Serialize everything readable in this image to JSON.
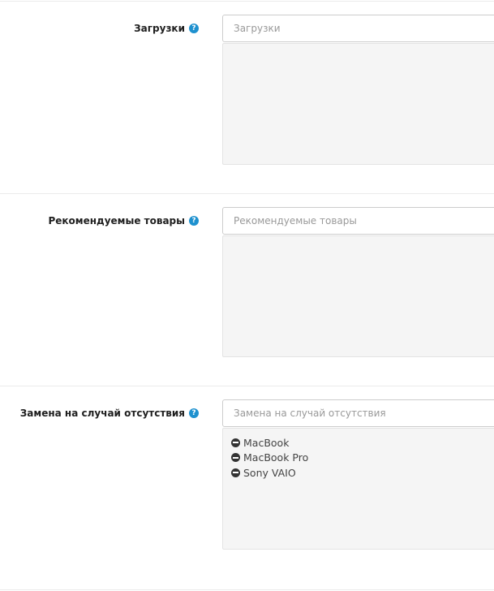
{
  "groups": [
    {
      "label": "Загрузки",
      "placeholder": "Загрузки",
      "items": []
    },
    {
      "label": "Рекомендуемые товары",
      "placeholder": "Рекомендуемые товары",
      "items": []
    },
    {
      "label": "Замена на случай отсутствия",
      "placeholder": "Замена на случай отсутствия",
      "items": [
        {
          "label": "MacBook"
        },
        {
          "label": "MacBook Pro"
        },
        {
          "label": "Sony VAIO"
        }
      ]
    }
  ],
  "help_glyph": "?",
  "icons": {
    "help": "question-circle-icon",
    "remove": "minus-circle-icon"
  },
  "colors": {
    "help_icon": "#1e91cf",
    "well_bg": "#f5f5f5",
    "divider": "#ebebeb"
  }
}
